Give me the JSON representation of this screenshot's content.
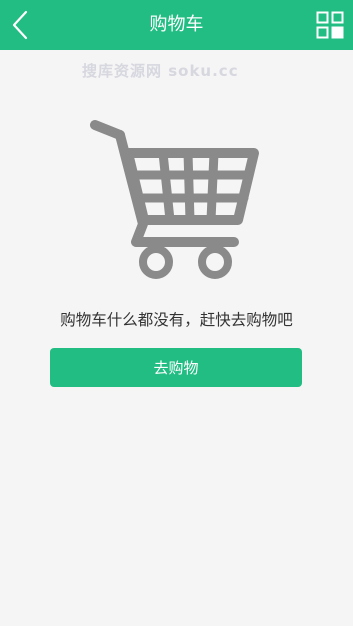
{
  "header": {
    "title": "购物车",
    "back_icon": "chevron-left-icon",
    "menu_icon": "grid-menu-icon",
    "background_color": "#21bd83"
  },
  "watermark": {
    "text": "搜库资源网 soku.cc"
  },
  "empty_state": {
    "illustration_icon": "shopping-cart-icon",
    "message": "购物车什么都没有，赶快去购物吧",
    "button_label": "去购物",
    "button_color": "#21bd83"
  }
}
